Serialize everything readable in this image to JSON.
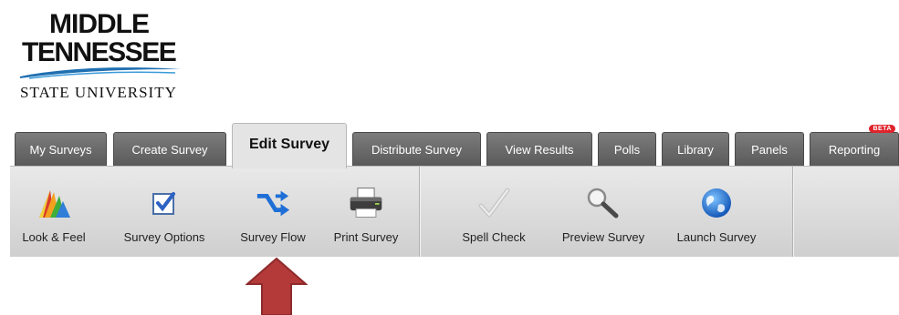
{
  "logo": {
    "line1": "MIDDLE",
    "line2": "TENNESSEE",
    "line3": "STATE UNIVERSITY"
  },
  "tabs": [
    {
      "label": "My Surveys"
    },
    {
      "label": "Create Survey"
    },
    {
      "label": "Edit Survey",
      "active": true
    },
    {
      "label": "Distribute Survey"
    },
    {
      "label": "View Results"
    },
    {
      "label": "Polls"
    },
    {
      "label": "Library"
    },
    {
      "label": "Panels"
    },
    {
      "label": "Reporting",
      "badge": "BETA"
    }
  ],
  "toolbar": {
    "items": [
      {
        "label": "Look & Feel",
        "icon": "look-and-feel-icon"
      },
      {
        "label": "Survey Options",
        "icon": "checkbox-icon"
      },
      {
        "label": "Survey Flow",
        "icon": "flow-arrows-icon"
      },
      {
        "label": "Print Survey",
        "icon": "printer-icon"
      },
      {
        "label": "Spell Check",
        "icon": "checkmark-icon"
      },
      {
        "label": "Preview Survey",
        "icon": "magnifier-icon"
      },
      {
        "label": "Launch Survey",
        "icon": "globe-icon"
      }
    ]
  },
  "annotation": {
    "arrow_color": "#b43a3a"
  }
}
